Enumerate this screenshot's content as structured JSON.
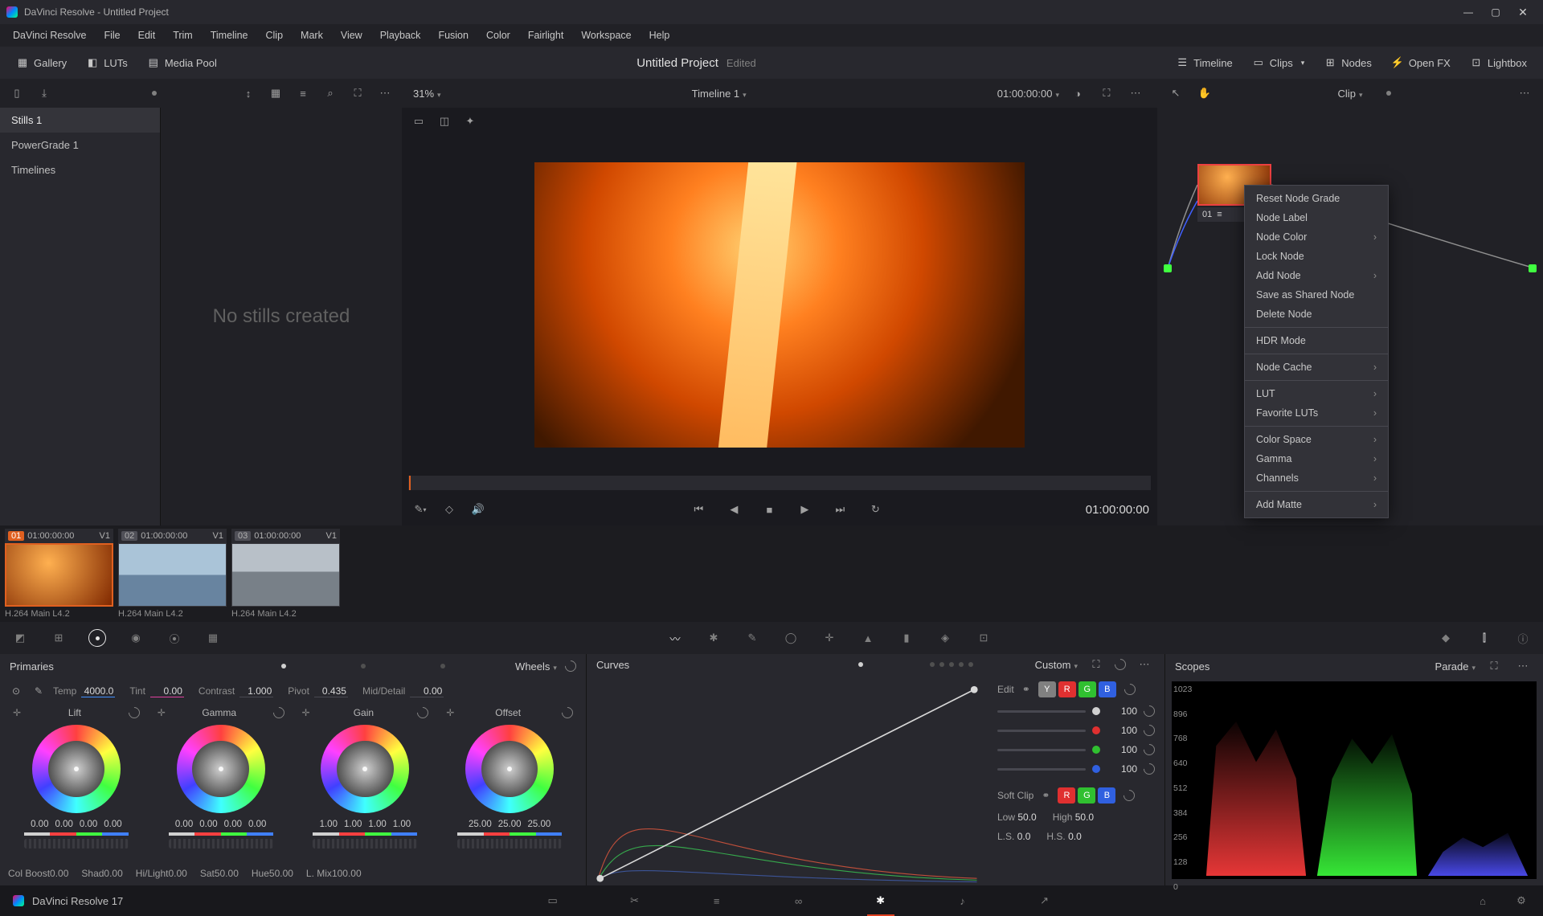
{
  "titlebar": {
    "text": "DaVinci Resolve - Untitled Project"
  },
  "menubar": [
    "DaVinci Resolve",
    "File",
    "Edit",
    "Trim",
    "Timeline",
    "Clip",
    "Mark",
    "View",
    "Playback",
    "Fusion",
    "Color",
    "Fairlight",
    "Workspace",
    "Help"
  ],
  "secondbar": {
    "left": [
      "Gallery",
      "LUTs",
      "Media Pool"
    ],
    "project": "Untitled Project",
    "edited": "Edited",
    "right": [
      "Timeline",
      "Clips",
      "Nodes",
      "Open FX",
      "Lightbox"
    ]
  },
  "thirdbar": {
    "zoom": "31%",
    "timeline_name": "Timeline 1",
    "timecode": "01:00:00:00",
    "node_mode": "Clip"
  },
  "gallery": {
    "items": [
      "Stills 1",
      "PowerGrade 1",
      "Timelines"
    ],
    "empty_text": "No stills created"
  },
  "viewer": {
    "tc": "01:00:00:00"
  },
  "node": {
    "label_num": "01",
    "context_menu": [
      "_Reset Node Grade",
      "Node Label",
      "Node Color >",
      "Lock Node",
      "Add Node >",
      "Save as Shared Node",
      "Delete Node",
      "-",
      "HDR Mode",
      "-",
      "Node Cache >",
      "-",
      "LUT >",
      "Favorite LUTs >",
      "-",
      "Color Space >",
      "Gamma >",
      "Channels >",
      "-",
      "Add Matte >"
    ]
  },
  "clips": [
    {
      "num": "01",
      "tc": "01:00:00:00",
      "track": "V1",
      "name": "H.264 Main L4.2",
      "sel": true,
      "th": "orange"
    },
    {
      "num": "02",
      "tc": "01:00:00:00",
      "track": "V1",
      "name": "H.264 Main L4.2",
      "sel": false,
      "th": "lake"
    },
    {
      "num": "03",
      "tc": "01:00:00:00",
      "track": "V1",
      "name": "H.264 Main L4.2",
      "sel": false,
      "th": "river"
    }
  ],
  "primaries": {
    "title": "Primaries",
    "mode": "Wheels",
    "adjust_top": [
      {
        "lbl": "Temp",
        "val": "4000.0",
        "cls": "temp"
      },
      {
        "lbl": "Tint",
        "val": "0.00",
        "cls": "tint"
      },
      {
        "lbl": "Contrast",
        "val": "1.000"
      },
      {
        "lbl": "Pivot",
        "val": "0.435"
      },
      {
        "lbl": "Mid/Detail",
        "val": "0.00"
      }
    ],
    "wheels": [
      {
        "name": "Lift",
        "vals": [
          "0.00",
          "0.00",
          "0.00",
          "0.00"
        ]
      },
      {
        "name": "Gamma",
        "vals": [
          "0.00",
          "0.00",
          "0.00",
          "0.00"
        ]
      },
      {
        "name": "Gain",
        "vals": [
          "1.00",
          "1.00",
          "1.00",
          "1.00"
        ]
      },
      {
        "name": "Offset",
        "vals": [
          "25.00",
          "25.00",
          "25.00"
        ]
      }
    ],
    "adjust_bottom": [
      {
        "lbl": "Col Boost",
        "val": "0.00"
      },
      {
        "lbl": "Shad",
        "val": "0.00"
      },
      {
        "lbl": "Hi/Light",
        "val": "0.00"
      },
      {
        "lbl": "Sat",
        "val": "50.00"
      },
      {
        "lbl": "Hue",
        "val": "50.00"
      },
      {
        "lbl": "L. Mix",
        "val": "100.00"
      }
    ]
  },
  "curves": {
    "title": "Curves",
    "mode": "Custom",
    "edit_label": "Edit",
    "channel_values": [
      "100",
      "100",
      "100",
      "100"
    ],
    "softclip_label": "Soft Clip",
    "low_label": "Low",
    "low_val": "50.0",
    "high_label": "High",
    "high_val": "50.0",
    "ls_label": "L.S.",
    "ls_val": "0.0",
    "hs_label": "H.S.",
    "hs_val": "0.0"
  },
  "scopes": {
    "title": "Scopes",
    "mode": "Parade",
    "y_labels": [
      "1023",
      "896",
      "768",
      "640",
      "512",
      "384",
      "256",
      "128",
      "0"
    ]
  },
  "pagebar": {
    "version": "DaVinci Resolve 17"
  }
}
